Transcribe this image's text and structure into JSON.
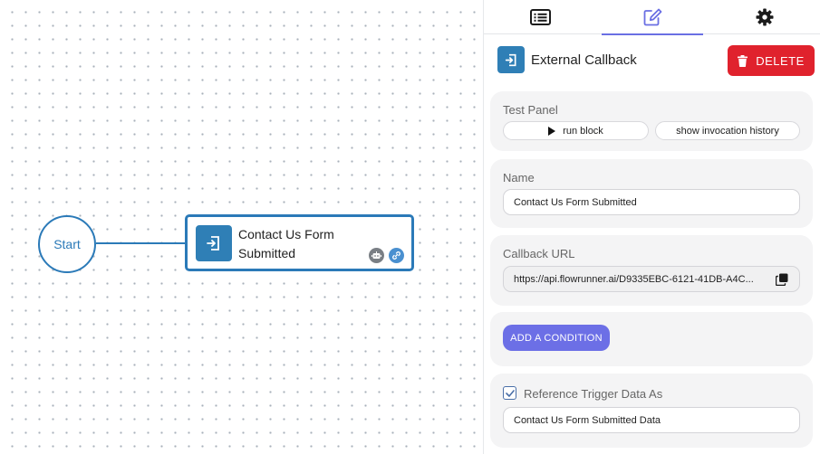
{
  "canvas": {
    "start_label": "Start",
    "block": {
      "title": "Contact Us Form Submitted",
      "icon": "callback-icon",
      "badges": [
        "robot-icon",
        "link-icon"
      ]
    }
  },
  "panel": {
    "tabs": [
      {
        "icon": "list-icon",
        "active": false
      },
      {
        "icon": "edit-icon",
        "active": true
      },
      {
        "icon": "gear-icon",
        "active": false
      }
    ],
    "header": {
      "icon": "callback-icon",
      "title": "External Callback",
      "delete_label": "DELETE"
    },
    "test_panel": {
      "label": "Test Panel",
      "run_label": "run block",
      "history_label": "show invocation history"
    },
    "name": {
      "label": "Name",
      "value": "Contact Us Form Submitted"
    },
    "callback": {
      "label": "Callback URL",
      "value": "https://api.flowrunner.ai/D9335EBC-6121-41DB-A4C..."
    },
    "condition": {
      "button_label": "ADD A CONDITION"
    },
    "reference": {
      "checked": true,
      "label": "Reference Trigger Data As",
      "value": "Contact Us Form Submitted Data"
    }
  },
  "colors": {
    "node_blue": "#2b7ab8",
    "delete_red": "#e0222d",
    "accent_purple": "#6c6fe6"
  }
}
